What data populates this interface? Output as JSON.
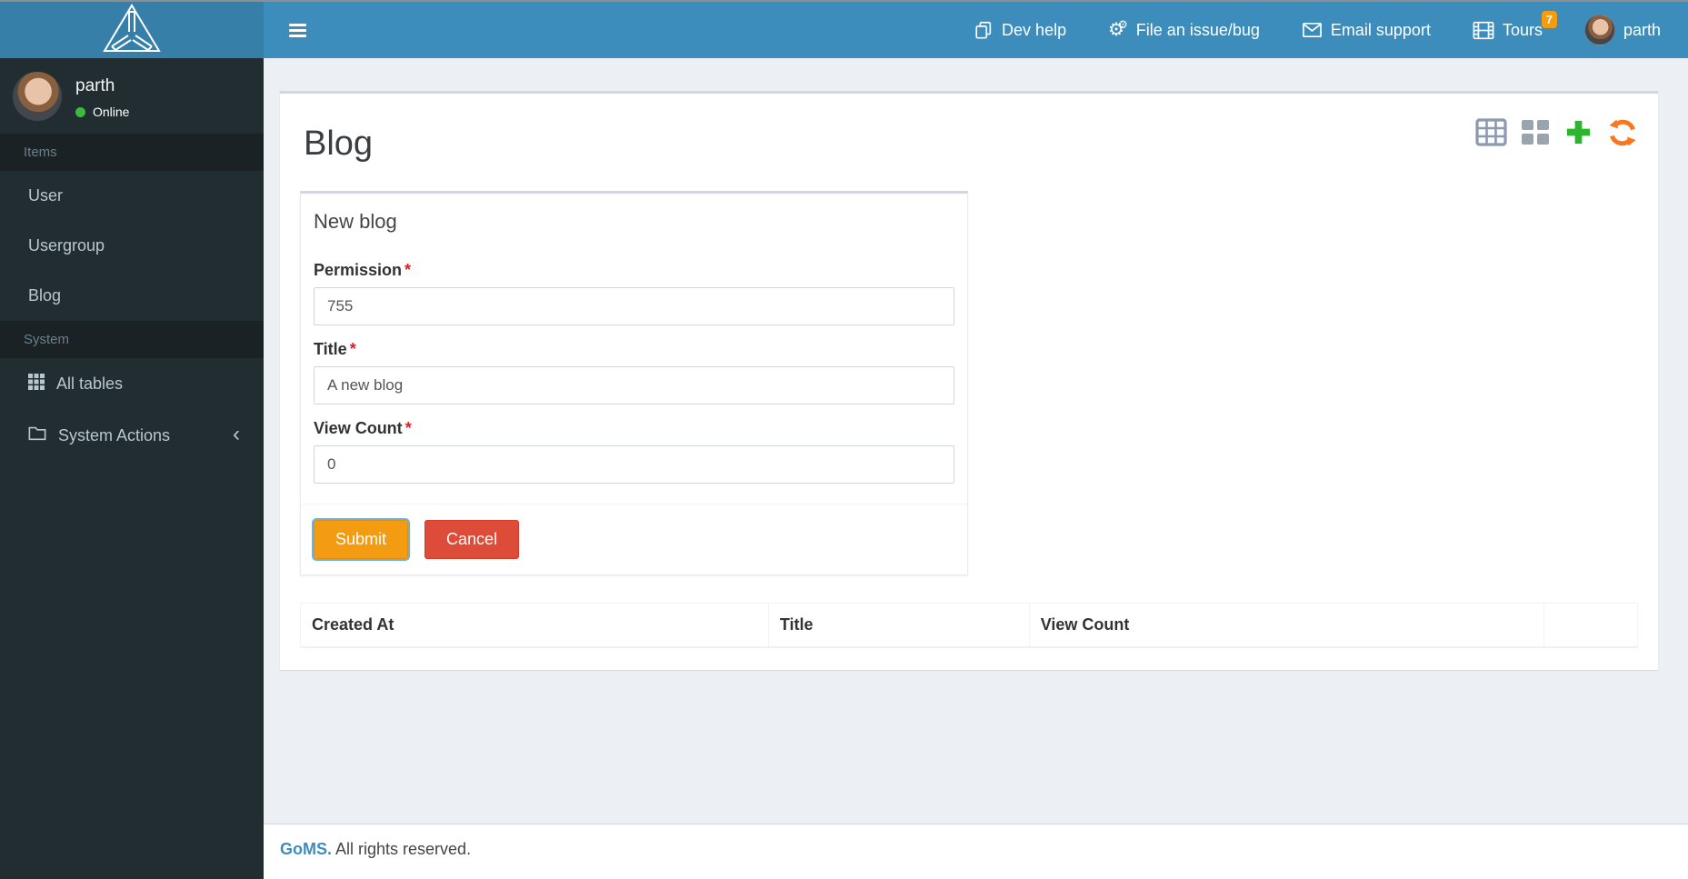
{
  "navbar": {
    "menu": [
      {
        "label": "Dev help",
        "icon": "copy-icon"
      },
      {
        "label": "File an issue/bug",
        "icon": "gears-icon"
      },
      {
        "label": "Email support",
        "icon": "envelope-icon"
      },
      {
        "label": "Tours",
        "icon": "film-icon",
        "badge": "7"
      }
    ],
    "user": "parth"
  },
  "sidebar": {
    "user": {
      "name": "parth",
      "status": "Online"
    },
    "sections": [
      {
        "header": "Items",
        "items": [
          {
            "label": "User"
          },
          {
            "label": "Usergroup"
          },
          {
            "label": "Blog"
          }
        ]
      },
      {
        "header": "System",
        "items": [
          {
            "label": "All tables",
            "icon": "grid-icon"
          },
          {
            "label": "System Actions",
            "icon": "folder-icon",
            "chevron": "‹"
          }
        ]
      }
    ]
  },
  "content": {
    "page_title": "Blog",
    "tools": [
      "table-view-icon",
      "blocks-view-icon",
      "add-icon",
      "refresh-icon"
    ],
    "card": {
      "title": "New blog",
      "required_marker": "*",
      "fields": [
        {
          "label": "Permission",
          "required": true,
          "value": "755"
        },
        {
          "label": "Title",
          "required": true,
          "value": "A new blog"
        },
        {
          "label": "View Count",
          "required": true,
          "value": "0"
        }
      ],
      "submit_label": "Submit",
      "cancel_label": "Cancel"
    },
    "table": {
      "headers": [
        "Created At",
        "Title",
        "View Count",
        ""
      ]
    }
  },
  "footer": {
    "brand": "GoMS.",
    "text": "All rights reserved."
  },
  "colors": {
    "navbar": "#3c8dbc",
    "logo_bg": "#367fa9",
    "sidebar_bg": "#222d32",
    "section_header_bg": "#1a2226",
    "content_bg": "#ecf0f5",
    "box_border_top": "#d2d6de",
    "submit_button": "#f39c12",
    "cancel_button": "#dd4b39",
    "tours_badge": "#f39c12",
    "online_dot": "#3db93d",
    "add_icon": "#2db52d",
    "refresh_icon": "#f8791d",
    "table_view_icon": "#8c9ab0",
    "blocks_view_icon": "#9aa4ae",
    "brand_link": "#3c8dbc",
    "required_asterisk": "#e51c23"
  }
}
